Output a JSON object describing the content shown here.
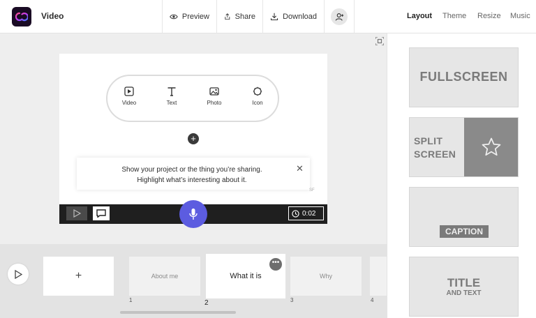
{
  "header": {
    "app_title": "Video",
    "preview_label": "Preview",
    "share_label": "Share",
    "download_label": "Download",
    "tabs": [
      {
        "label": "Layout",
        "active": true
      },
      {
        "label": "Theme",
        "active": false
      },
      {
        "label": "Resize",
        "active": false
      },
      {
        "label": "Music",
        "active": false
      }
    ]
  },
  "canvas": {
    "media_options": [
      {
        "label": "Video",
        "icon": "video-icon"
      },
      {
        "label": "Text",
        "icon": "text-icon"
      },
      {
        "label": "Photo",
        "icon": "photo-icon"
      },
      {
        "label": "Icon",
        "icon": "icon-icon"
      }
    ],
    "add_symbol": "+",
    "tip_line1": "Show your project or the thing you’re sharing.",
    "tip_line2": "Highlight what’s interesting about it.",
    "close_symbol": "✕",
    "mark": "SF",
    "timer": "0:02"
  },
  "scenes": {
    "add_symbol": "+",
    "items": [
      {
        "label": "About me",
        "number": "1",
        "active": false
      },
      {
        "label": "What it is",
        "number": "2",
        "active": true
      },
      {
        "label": "Why",
        "number": "3",
        "active": false
      },
      {
        "label": "",
        "number": "4",
        "active": false
      }
    ],
    "more_symbol": "•••"
  },
  "layouts": {
    "fullscreen": "FULLSCREEN",
    "split_line1": "SPLIT",
    "split_line2": "SCREEN",
    "caption": "CAPTION",
    "title": "TITLE",
    "title_sub": "AND TEXT"
  },
  "colors": {
    "accent_mic": "#5c5ce0",
    "logo_bg": "#1a0b24"
  }
}
